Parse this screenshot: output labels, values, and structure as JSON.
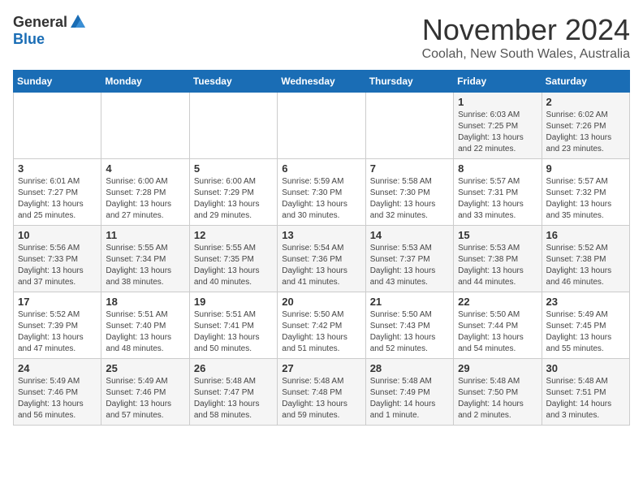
{
  "logo": {
    "general": "General",
    "blue": "Blue"
  },
  "header": {
    "month": "November 2024",
    "location": "Coolah, New South Wales, Australia"
  },
  "weekdays": [
    "Sunday",
    "Monday",
    "Tuesday",
    "Wednesday",
    "Thursday",
    "Friday",
    "Saturday"
  ],
  "weeks": [
    [
      {
        "day": "",
        "info": ""
      },
      {
        "day": "",
        "info": ""
      },
      {
        "day": "",
        "info": ""
      },
      {
        "day": "",
        "info": ""
      },
      {
        "day": "",
        "info": ""
      },
      {
        "day": "1",
        "info": "Sunrise: 6:03 AM\nSunset: 7:25 PM\nDaylight: 13 hours and 22 minutes."
      },
      {
        "day": "2",
        "info": "Sunrise: 6:02 AM\nSunset: 7:26 PM\nDaylight: 13 hours and 23 minutes."
      }
    ],
    [
      {
        "day": "3",
        "info": "Sunrise: 6:01 AM\nSunset: 7:27 PM\nDaylight: 13 hours and 25 minutes."
      },
      {
        "day": "4",
        "info": "Sunrise: 6:00 AM\nSunset: 7:28 PM\nDaylight: 13 hours and 27 minutes."
      },
      {
        "day": "5",
        "info": "Sunrise: 6:00 AM\nSunset: 7:29 PM\nDaylight: 13 hours and 29 minutes."
      },
      {
        "day": "6",
        "info": "Sunrise: 5:59 AM\nSunset: 7:30 PM\nDaylight: 13 hours and 30 minutes."
      },
      {
        "day": "7",
        "info": "Sunrise: 5:58 AM\nSunset: 7:30 PM\nDaylight: 13 hours and 32 minutes."
      },
      {
        "day": "8",
        "info": "Sunrise: 5:57 AM\nSunset: 7:31 PM\nDaylight: 13 hours and 33 minutes."
      },
      {
        "day": "9",
        "info": "Sunrise: 5:57 AM\nSunset: 7:32 PM\nDaylight: 13 hours and 35 minutes."
      }
    ],
    [
      {
        "day": "10",
        "info": "Sunrise: 5:56 AM\nSunset: 7:33 PM\nDaylight: 13 hours and 37 minutes."
      },
      {
        "day": "11",
        "info": "Sunrise: 5:55 AM\nSunset: 7:34 PM\nDaylight: 13 hours and 38 minutes."
      },
      {
        "day": "12",
        "info": "Sunrise: 5:55 AM\nSunset: 7:35 PM\nDaylight: 13 hours and 40 minutes."
      },
      {
        "day": "13",
        "info": "Sunrise: 5:54 AM\nSunset: 7:36 PM\nDaylight: 13 hours and 41 minutes."
      },
      {
        "day": "14",
        "info": "Sunrise: 5:53 AM\nSunset: 7:37 PM\nDaylight: 13 hours and 43 minutes."
      },
      {
        "day": "15",
        "info": "Sunrise: 5:53 AM\nSunset: 7:38 PM\nDaylight: 13 hours and 44 minutes."
      },
      {
        "day": "16",
        "info": "Sunrise: 5:52 AM\nSunset: 7:38 PM\nDaylight: 13 hours and 46 minutes."
      }
    ],
    [
      {
        "day": "17",
        "info": "Sunrise: 5:52 AM\nSunset: 7:39 PM\nDaylight: 13 hours and 47 minutes."
      },
      {
        "day": "18",
        "info": "Sunrise: 5:51 AM\nSunset: 7:40 PM\nDaylight: 13 hours and 48 minutes."
      },
      {
        "day": "19",
        "info": "Sunrise: 5:51 AM\nSunset: 7:41 PM\nDaylight: 13 hours and 50 minutes."
      },
      {
        "day": "20",
        "info": "Sunrise: 5:50 AM\nSunset: 7:42 PM\nDaylight: 13 hours and 51 minutes."
      },
      {
        "day": "21",
        "info": "Sunrise: 5:50 AM\nSunset: 7:43 PM\nDaylight: 13 hours and 52 minutes."
      },
      {
        "day": "22",
        "info": "Sunrise: 5:50 AM\nSunset: 7:44 PM\nDaylight: 13 hours and 54 minutes."
      },
      {
        "day": "23",
        "info": "Sunrise: 5:49 AM\nSunset: 7:45 PM\nDaylight: 13 hours and 55 minutes."
      }
    ],
    [
      {
        "day": "24",
        "info": "Sunrise: 5:49 AM\nSunset: 7:46 PM\nDaylight: 13 hours and 56 minutes."
      },
      {
        "day": "25",
        "info": "Sunrise: 5:49 AM\nSunset: 7:46 PM\nDaylight: 13 hours and 57 minutes."
      },
      {
        "day": "26",
        "info": "Sunrise: 5:48 AM\nSunset: 7:47 PM\nDaylight: 13 hours and 58 minutes."
      },
      {
        "day": "27",
        "info": "Sunrise: 5:48 AM\nSunset: 7:48 PM\nDaylight: 13 hours and 59 minutes."
      },
      {
        "day": "28",
        "info": "Sunrise: 5:48 AM\nSunset: 7:49 PM\nDaylight: 14 hours and 1 minute."
      },
      {
        "day": "29",
        "info": "Sunrise: 5:48 AM\nSunset: 7:50 PM\nDaylight: 14 hours and 2 minutes."
      },
      {
        "day": "30",
        "info": "Sunrise: 5:48 AM\nSunset: 7:51 PM\nDaylight: 14 hours and 3 minutes."
      }
    ]
  ]
}
